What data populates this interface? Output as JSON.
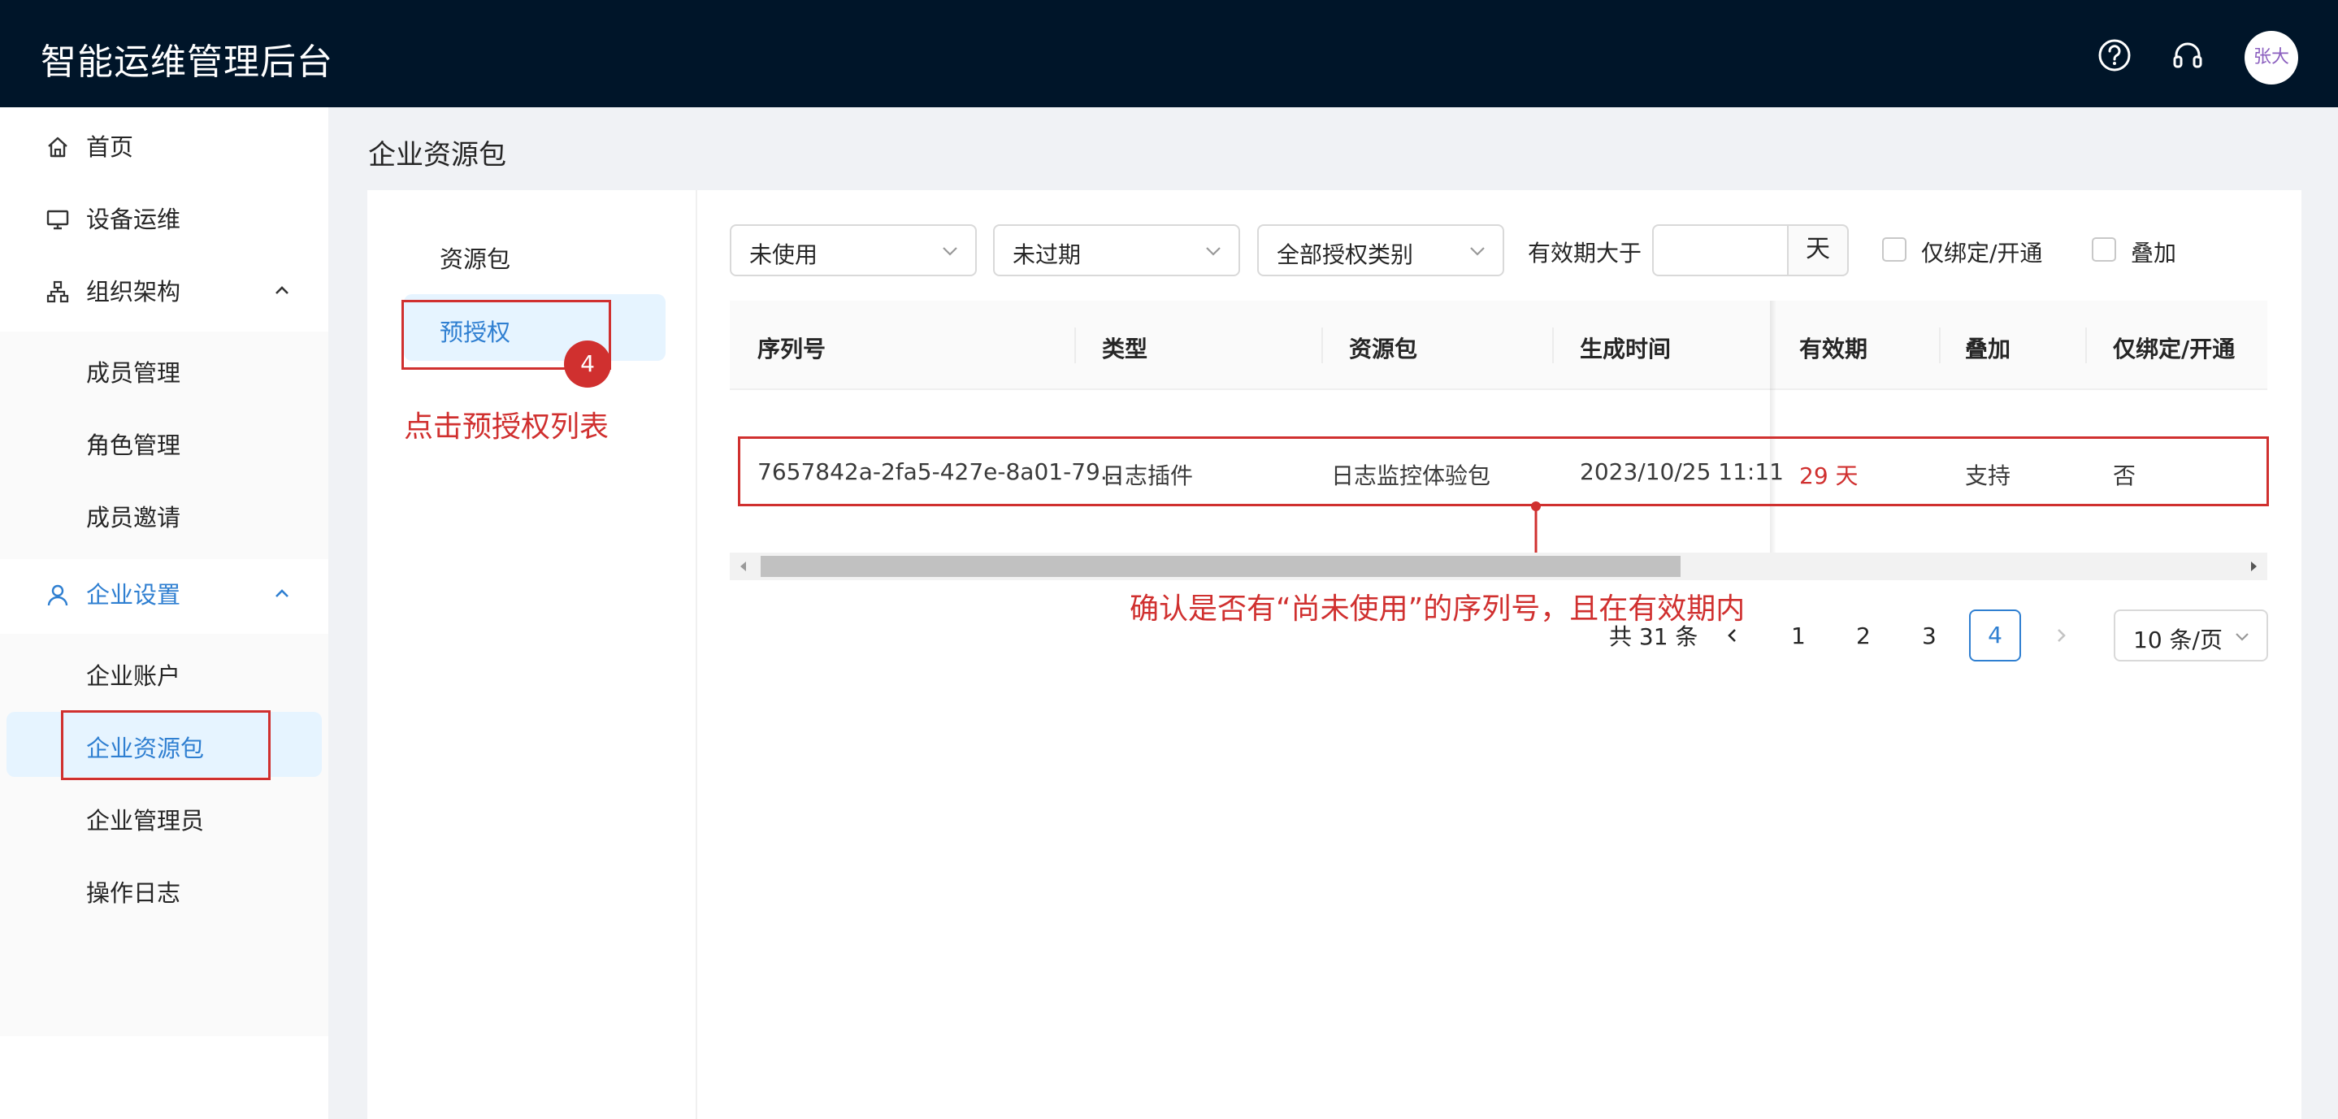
{
  "header": {
    "title": "智能运维管理后台",
    "avatar_text": "张大"
  },
  "sidebar": {
    "items": [
      {
        "label": "首页",
        "icon": "home-icon"
      },
      {
        "label": "设备运维",
        "icon": "monitor-icon"
      },
      {
        "label": "组织架构",
        "icon": "org-chart-icon",
        "expanded": true,
        "children": [
          {
            "label": "成员管理"
          },
          {
            "label": "角色管理"
          },
          {
            "label": "成员邀请"
          }
        ]
      },
      {
        "label": "企业设置",
        "icon": "user-icon",
        "expanded": true,
        "active": true,
        "children": [
          {
            "label": "企业账户"
          },
          {
            "label": "企业资源包",
            "selected": true
          },
          {
            "label": "企业管理员"
          },
          {
            "label": "操作日志"
          }
        ]
      }
    ]
  },
  "page": {
    "title": "企业资源包"
  },
  "tabs": [
    {
      "label": "资源包"
    },
    {
      "label": "预授权",
      "active": true
    }
  ],
  "annotations": {
    "step_badge": "4",
    "tab_note": "点击预授权列表",
    "row_note": "确认是否有“尚未使用”的序列号，且在有效期内",
    "highlight_color": "#d0302f"
  },
  "filters": {
    "usage_status": "未使用",
    "expiry_status": "未过期",
    "auth_type": "全部授权类别",
    "validity_label": "有效期大于",
    "validity_value": "",
    "validity_unit": "天",
    "bind_only_label": "仅绑定/开通",
    "stack_label": "叠加"
  },
  "table": {
    "columns": [
      "序列号",
      "类型",
      "资源包",
      "生成时间",
      "有效期",
      "叠加",
      "仅绑定/开通"
    ],
    "rows": [
      {
        "serial": "7657842a-2fa5-427e-8a01-79...",
        "type": "日志插件",
        "package": "日志监控体验包",
        "created": "2023/10/25 11:11",
        "validity": "29 天",
        "stackable": "支持",
        "bind_only": "否"
      }
    ]
  },
  "pagination": {
    "total_text": "共 31 条",
    "pages": [
      "1",
      "2",
      "3",
      "4"
    ],
    "current": "4",
    "page_size": "10 条/页"
  },
  "colors": {
    "header_bg": "#001529",
    "accent": "#2f7fd1",
    "selected_bg": "#e6f4ff",
    "alert": "#d0302f"
  }
}
